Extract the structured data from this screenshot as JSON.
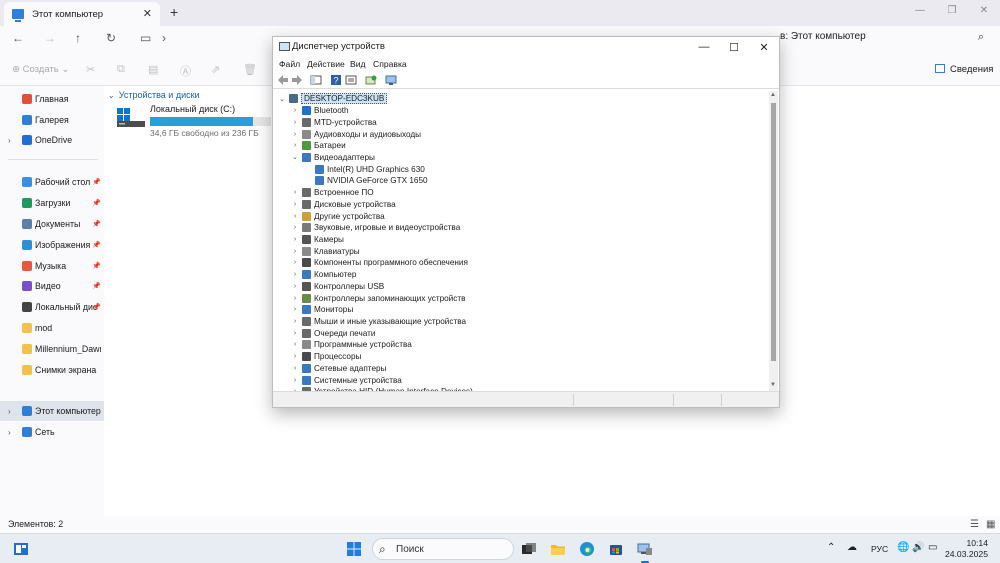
{
  "explorer": {
    "tab_title": "Этот компьютер",
    "address_right": "в: Этот компьютер",
    "toolbar": {
      "create_label": "Создать",
      "details_label": "Сведения"
    },
    "sidebar": {
      "items": [
        {
          "label": "Главная",
          "name": "sidebar-item-home",
          "color": "#e0533a",
          "chev": ""
        },
        {
          "label": "Галерея",
          "name": "sidebar-item-gallery",
          "color": "#2d7fd8",
          "chev": ""
        },
        {
          "label": "OneDrive",
          "name": "sidebar-item-onedrive",
          "color": "#1f6fd0",
          "chev": "›"
        },
        {
          "label": "Рабочий стол",
          "name": "sidebar-item-desktop",
          "color": "#3a8ee6",
          "pin": true
        },
        {
          "label": "Загрузки",
          "name": "sidebar-item-downloads",
          "color": "#1e9a5c",
          "pin": true
        },
        {
          "label": "Документы",
          "name": "sidebar-item-documents",
          "color": "#5b7fa8",
          "pin": true
        },
        {
          "label": "Изображения",
          "name": "sidebar-item-pictures",
          "color": "#2f8fd5",
          "pin": true
        },
        {
          "label": "Музыка",
          "name": "sidebar-item-music",
          "color": "#e45a3b",
          "pin": true
        },
        {
          "label": "Видео",
          "name": "sidebar-item-videos",
          "color": "#7b4fc7",
          "pin": true
        },
        {
          "label": "Локальный дис",
          "name": "sidebar-item-local-disk",
          "color": "#444444",
          "pin": true
        },
        {
          "label": "mod",
          "name": "sidebar-item-mod",
          "color": "#f0c24b"
        },
        {
          "label": "Millennium_Dawn_",
          "name": "sidebar-item-millennium",
          "color": "#f0c24b"
        },
        {
          "label": "Снимки экрана",
          "name": "sidebar-item-screenshots",
          "color": "#f0c24b"
        },
        {
          "label": "Этот компьютер",
          "name": "sidebar-item-this-pc",
          "color": "#2d7fd8",
          "chev": "›",
          "active": true
        },
        {
          "label": "Сеть",
          "name": "sidebar-item-network",
          "color": "#2d7fd8",
          "chev": "›"
        }
      ]
    },
    "content": {
      "section_header": "Устройства и диски",
      "drive": {
        "name": "Локальный диск (C:)",
        "free_text": "34,6 ГБ свободно из 236 ГБ",
        "used_fraction": 0.853
      }
    },
    "status_text": "Элементов: 2"
  },
  "devmgr": {
    "title": "Диспетчер устройств",
    "menu": [
      "Файл",
      "Действие",
      "Вид",
      "Справка"
    ],
    "tree": [
      {
        "label": "DESKTOP-EDC3KUB",
        "level": 0,
        "expand": "v",
        "icon": "#4a6a8a",
        "icon_name": "computer-icon",
        "root": true
      },
      {
        "label": "Bluetooth",
        "level": 1,
        "expand": ">",
        "icon": "#1f6fd0",
        "icon_name": "bluetooth-icon"
      },
      {
        "label": "MTD-устройства",
        "level": 1,
        "expand": ">",
        "icon": "#6a6a6a",
        "icon_name": "mtd-icon"
      },
      {
        "label": "Аудиовходы и аудиовыходы",
        "level": 1,
        "expand": ">",
        "icon": "#8a8a8a",
        "icon_name": "audio-io-icon"
      },
      {
        "label": "Батареи",
        "level": 1,
        "expand": ">",
        "icon": "#4f9a3a",
        "icon_name": "battery-icon"
      },
      {
        "label": "Видеоадаптеры",
        "level": 1,
        "expand": "v",
        "icon": "#3b78c4",
        "icon_name": "display-adapter-icon"
      },
      {
        "label": "Intel(R) UHD Graphics 630",
        "level": 2,
        "expand": "",
        "icon": "#3b78c4",
        "icon_name": "gpu-icon"
      },
      {
        "label": "NVIDIA GeForce GTX 1650",
        "level": 2,
        "expand": "",
        "icon": "#3b78c4",
        "icon_name": "gpu-icon"
      },
      {
        "label": "Встроенное ПО",
        "level": 1,
        "expand": ">",
        "icon": "#6a6a6a",
        "icon_name": "firmware-icon"
      },
      {
        "label": "Дисковые устройства",
        "level": 1,
        "expand": ">",
        "icon": "#6a6a6a",
        "icon_name": "disk-drive-icon"
      },
      {
        "label": "Другие устройства",
        "level": 1,
        "expand": ">",
        "icon": "#c9a13a",
        "icon_name": "other-devices-icon"
      },
      {
        "label": "Звуковые, игровые и видеоустройства",
        "level": 1,
        "expand": ">",
        "icon": "#7a7a7a",
        "icon_name": "sound-icon"
      },
      {
        "label": "Камеры",
        "level": 1,
        "expand": ">",
        "icon": "#555555",
        "icon_name": "camera-icon"
      },
      {
        "label": "Клавиатуры",
        "level": 1,
        "expand": ">",
        "icon": "#8a8a8a",
        "icon_name": "keyboard-icon"
      },
      {
        "label": "Компоненты программного обеспечения",
        "level": 1,
        "expand": ">",
        "icon": "#4a4a4a",
        "icon_name": "software-component-icon"
      },
      {
        "label": "Компьютер",
        "level": 1,
        "expand": ">",
        "icon": "#3b78c4",
        "icon_name": "computer-node-icon"
      },
      {
        "label": "Контроллеры USB",
        "level": 1,
        "expand": ">",
        "icon": "#555555",
        "icon_name": "usb-icon"
      },
      {
        "label": "Контроллеры запоминающих устройств",
        "level": 1,
        "expand": ">",
        "icon": "#6a8a4a",
        "icon_name": "storage-controller-icon"
      },
      {
        "label": "Мониторы",
        "level": 1,
        "expand": ">",
        "icon": "#3b78c4",
        "icon_name": "monitor-icon"
      },
      {
        "label": "Мыши и иные указывающие устройства",
        "level": 1,
        "expand": ">",
        "icon": "#6a6a6a",
        "icon_name": "mouse-icon"
      },
      {
        "label": "Очереди печати",
        "level": 1,
        "expand": ">",
        "icon": "#6a6a6a",
        "icon_name": "printer-icon"
      },
      {
        "label": "Программные устройства",
        "level": 1,
        "expand": ">",
        "icon": "#8a8a8a",
        "icon_name": "software-device-icon"
      },
      {
        "label": "Процессоры",
        "level": 1,
        "expand": ">",
        "icon": "#4a4a4a",
        "icon_name": "processor-icon"
      },
      {
        "label": "Сетевые адаптеры",
        "level": 1,
        "expand": ">",
        "icon": "#3b78c4",
        "icon_name": "network-adapter-icon"
      },
      {
        "label": "Системные устройства",
        "level": 1,
        "expand": ">",
        "icon": "#3b78c4",
        "icon_name": "system-devices-icon"
      },
      {
        "label": "Устройства HID (Human Interface Devices)",
        "level": 1,
        "expand": ">",
        "icon": "#6a6a6a",
        "icon_name": "hid-icon"
      }
    ]
  },
  "taskbar": {
    "search_label": "Поиск",
    "language": "РУС",
    "time": "10:14",
    "date": "24.03.2025"
  }
}
